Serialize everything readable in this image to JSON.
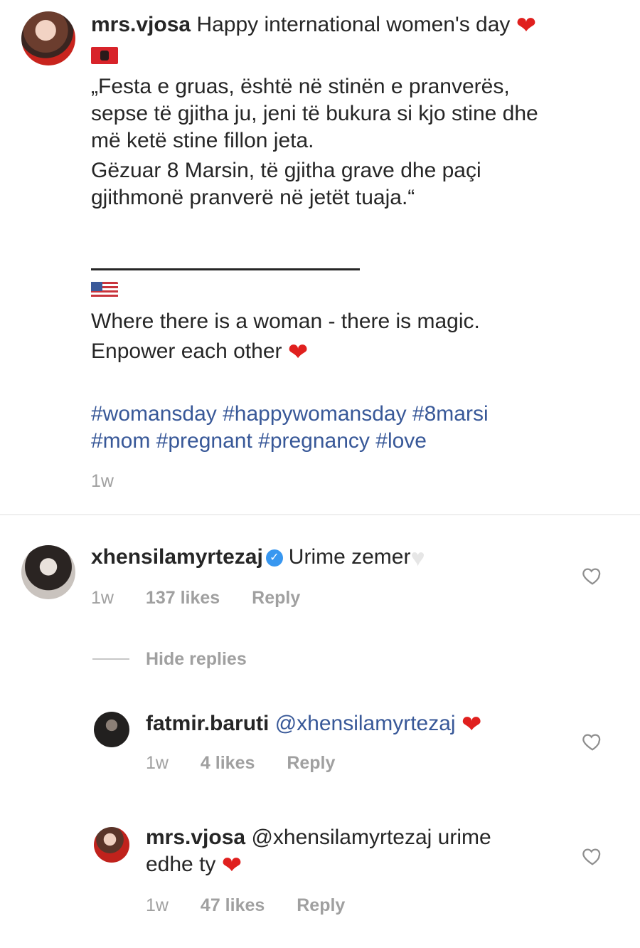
{
  "post": {
    "username": "mrs.vjosa",
    "caption_first": "Happy international women's day",
    "albanian_lines": [
      "„Festa e gruas, është në stinën e pranverës,",
      "sepse të gjitha ju, jeni të bukura si kjo stine dhe",
      "më ketë stine fillon jeta.",
      "Gëzuar 8 Marsin, të gjitha grave dhe paçi",
      "gjithmonë pranverë në jetët tuaja.“"
    ],
    "english_line1": "Where there is a woman - there is magic.",
    "english_line2": "Enpower each other",
    "hashtags_line1": "#womansday #happywomansday #8marsi",
    "hashtags_line2": "#mom #pregnant #pregnancy #love",
    "time": "1w"
  },
  "comments": [
    {
      "username": "xhensilamyrtezaj",
      "verified": true,
      "text": "Urime zemer",
      "time": "1w",
      "likes": "137 likes",
      "reply": "Reply",
      "hide_replies": "Hide replies",
      "replies": [
        {
          "username": "fatmir.baruti",
          "text": "@xhensilamyrtezaj",
          "time": "1w",
          "likes": "4 likes",
          "reply": "Reply"
        },
        {
          "username": "mrs.vjosa",
          "text_line1": "@xhensilamyrtezaj urime",
          "text_line2": "edhe ty",
          "time": "1w",
          "likes": "47 likes",
          "reply": "Reply"
        }
      ]
    }
  ],
  "icons": {
    "heart_emoji": "❤",
    "white_heart_emoji": "♥",
    "verified_check": "✓",
    "like_icon": "heart-outline-icon"
  },
  "colors": {
    "hashtag": "#385898",
    "meta": "#a0a0a0",
    "verified": "#3897f0",
    "heart": "#e0201e"
  }
}
